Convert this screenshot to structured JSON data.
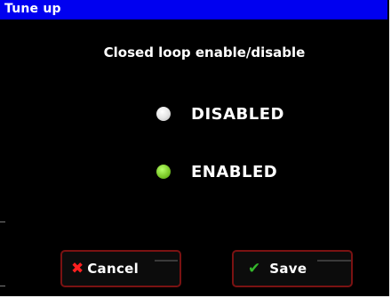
{
  "window": {
    "title": "Tune up"
  },
  "dialog": {
    "heading": "Closed loop enable/disable",
    "options": [
      {
        "label": "DISABLED",
        "selected": false,
        "dot_color": "#e6e6e6"
      },
      {
        "label": "ENABLED",
        "selected": true,
        "dot_color": "#7ecb2b"
      }
    ]
  },
  "buttons": {
    "cancel": {
      "label": "Cancel",
      "icon": "x-icon"
    },
    "save": {
      "label": "Save",
      "icon": "checkmark-icon"
    }
  },
  "colors": {
    "title_bar": "#0000f0",
    "background": "#000000",
    "button_border": "#7a1212",
    "cancel_icon": "#ff2020",
    "save_icon": "#35b82c"
  }
}
